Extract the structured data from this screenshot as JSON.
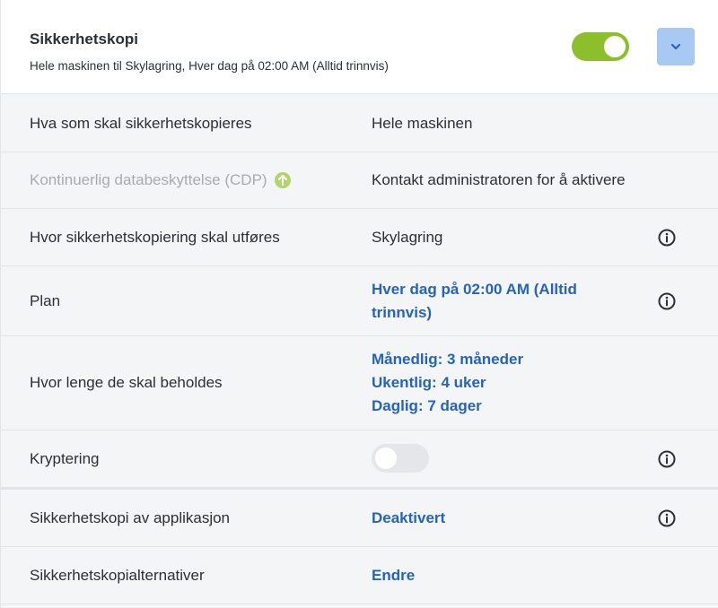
{
  "header": {
    "title": "Sikkerhetskopi",
    "subtitle": "Hele maskinen til Skylagring, Hver dag på 02:00 AM (Alltid trinnvis)",
    "toggle_on": true,
    "expand_icon": "chevron-down-icon"
  },
  "rows": {
    "what": {
      "label": "Hva som skal sikkerhetskopieres",
      "value": "Hele maskinen"
    },
    "cdp": {
      "label": "Kontinuerlig databeskyttelse (CDP)",
      "value": "Kontakt administratoren for å aktivere",
      "badge_icon": "upgrade-arrow-icon"
    },
    "where": {
      "label": "Hvor sikkerhetskopiering skal utføres",
      "value": "Skylagring"
    },
    "plan": {
      "label": "Plan",
      "value": "Hver dag på 02:00 AM (Alltid trinnvis)"
    },
    "retention": {
      "label": "Hvor lenge de skal beholdes",
      "values": [
        "Månedlig: 3 måneder",
        "Ukentlig: 4 uker",
        "Daglig: 7 dager"
      ]
    },
    "encryption": {
      "label": "Kryptering",
      "toggle_on": false
    },
    "app_backup": {
      "label": "Sikkerhetskopi av applikasjon",
      "value": "Deaktivert"
    },
    "options": {
      "label": "Sikkerhetskopialternativer",
      "value": "Endre"
    }
  },
  "colors": {
    "toggle_on": "#8dbf2c",
    "toggle_off": "#e4e6ea",
    "link": "#2563be",
    "expand_button": "#a9c9f5",
    "disabled_text": "#a7abb1"
  }
}
